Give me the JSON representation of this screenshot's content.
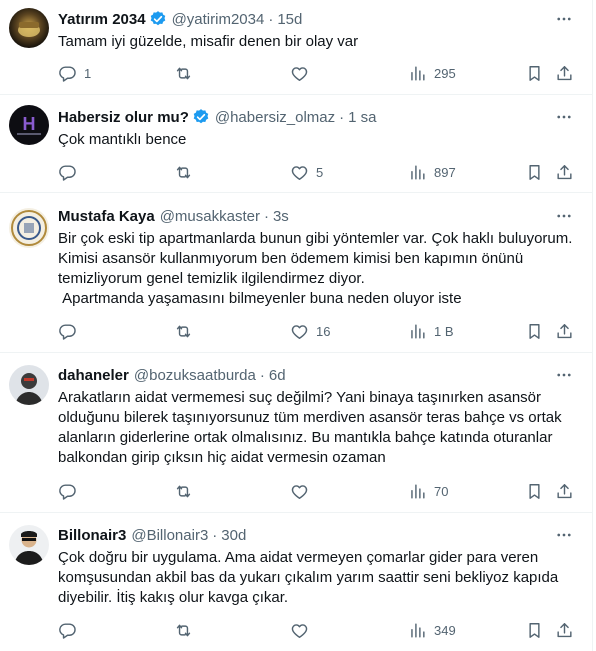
{
  "tweets": [
    {
      "name": "Yatırım 2034",
      "verified": true,
      "handle": "@yatirim2034",
      "time": "15d",
      "text": "Tamam iyi güzelde, misafir denen bir olay var",
      "replies": "1",
      "retweets": "",
      "likes": "",
      "views": "295"
    },
    {
      "name": "Habersiz olur mu?",
      "verified": true,
      "handle": "@habersiz_olmaz",
      "time": "1 sa",
      "text": "Çok mantıklı bence",
      "replies": "",
      "retweets": "",
      "likes": "5",
      "views": "897"
    },
    {
      "name": "Mustafa Kaya",
      "verified": false,
      "handle": "@musakkaster",
      "time": "3s",
      "text": "Bir çok eski tip apartmanlarda bunun gibi yöntemler var. Çok haklı buluyorum. Kimisi asansör kullanmıyorum ben ödemem kimisi ben kapımın önünü temizliyorum genel temizlik ilgilendirmez diyor.\n Apartmanda yaşamasını bilmeyenler buna neden oluyor iste",
      "replies": "",
      "retweets": "",
      "likes": "16",
      "views": "1 B"
    },
    {
      "name": "dahaneler",
      "verified": false,
      "handle": "@bozuksaatburda",
      "time": "6d",
      "text": "Arakatların aidat vermemesi suç değilmi? Yani binaya taşınırken asansör olduğunu bilerek taşınıyorsunuz tüm merdiven asansör teras bahçe vs ortak alanların giderlerine ortak olmalısınız. Bu mantıkla bahçe katında oturanlar balkondan girip çıksın hiç aidat vermesin ozaman",
      "replies": "",
      "retweets": "",
      "likes": "",
      "views": "70"
    },
    {
      "name": "Billonair3",
      "verified": false,
      "handle": "@Billonair3",
      "time": "30d",
      "text": "Çok doğru bir uygulama. Ama aidat vermeyen çomarlar gider para veren komşusundan akbil bas da yukarı çıkalım yarım saattir seni bekliyoz kapıda diyebilir. İtiş kakış olur kavga çıkar.",
      "replies": "",
      "retweets": "",
      "likes": "",
      "views": "349"
    }
  ],
  "icons": {
    "reply": "reply-icon",
    "retweet": "retweet-icon",
    "like": "like-icon",
    "views": "views-icon",
    "bookmark": "bookmark-icon",
    "share": "share-icon",
    "more": "more-icon",
    "verified": "verified-icon"
  },
  "colors": {
    "text": "#0f1419",
    "secondary": "#536471",
    "verified": "#1d9bf0",
    "divider": "#eff3f4"
  }
}
